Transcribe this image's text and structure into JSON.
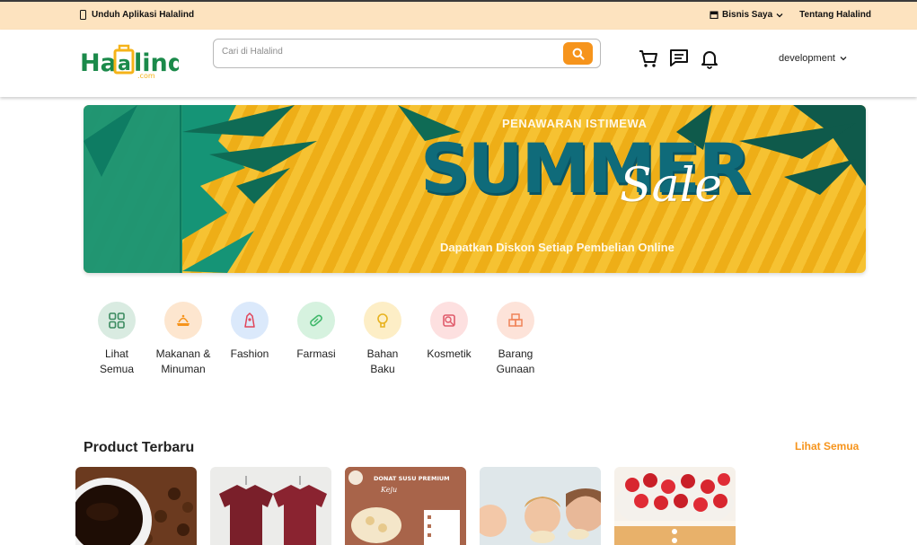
{
  "topbar": {
    "app_download": "Unduh Aplikasi Halalind",
    "business": "Bisnis Saya",
    "about": "Tentang Halalind"
  },
  "header": {
    "logo_text": "Halalind",
    "logo_sub": ".com",
    "search_placeholder": "Cari di Halalind",
    "user_name": "development"
  },
  "banner": {
    "subtitle": "PENAWARAN ISTIMEWA",
    "title": "SUMMER",
    "script": "Sale",
    "tagline": "Dapatkan Diskon Setiap Pembelian Online"
  },
  "categories": [
    {
      "label": "Lihat Semua",
      "icon": "grid-icon",
      "bg": "#d9ebe1",
      "color": "#3a8a5f"
    },
    {
      "label": "Makanan & Minuman",
      "icon": "food-icon",
      "bg": "#fde6cf",
      "color": "#f6941c"
    },
    {
      "label": "Fashion",
      "icon": "fashion-icon",
      "bg": "#dbe9fb",
      "color": "#e0455a"
    },
    {
      "label": "Farmasi",
      "icon": "pill-icon",
      "bg": "#d6f2df",
      "color": "#3fb86a"
    },
    {
      "label": "Bahan Baku",
      "icon": "ingredient-icon",
      "bg": "#fdeec6",
      "color": "#e8b21e"
    },
    {
      "label": "Kosmetik",
      "icon": "cosmetic-icon",
      "bg": "#fde0e0",
      "color": "#e05a6a"
    },
    {
      "label": "Barang Gunaan",
      "icon": "goods-icon",
      "bg": "#fde3d9",
      "color": "#f08358"
    }
  ],
  "products_section": {
    "title": "Product Terbaru",
    "see_all": "Lihat Semua"
  },
  "products": [
    {
      "name": "coffee-product"
    },
    {
      "name": "tshirt-product"
    },
    {
      "name": "donut-product",
      "label": "DONAT SUSU PREMIUM"
    },
    {
      "name": "kids-snack-product"
    },
    {
      "name": "strawberry-cake-product"
    }
  ],
  "colors": {
    "accent": "#f6941c",
    "topbar_bg": "#fde3bf",
    "brand_green": "#1b8a4a",
    "brand_yellow": "#f5b319"
  }
}
